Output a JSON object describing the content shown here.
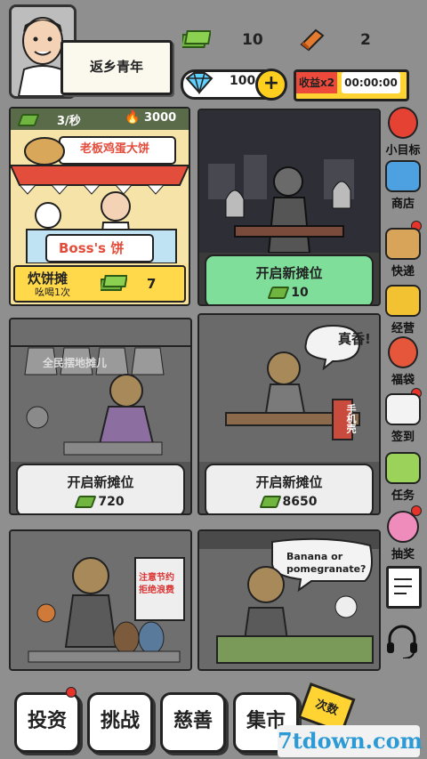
{
  "header": {
    "title": "返乡青年",
    "cash": "10",
    "bricks": "2",
    "diamonds": "100",
    "plus_label": "+",
    "boost_label": "收益x2",
    "timer": "00:00:00"
  },
  "stalls": [
    {
      "rate": "3/秒",
      "fire": "3000",
      "sign": "老板鸡蛋大饼",
      "board": "Boss's 饼",
      "name": "炊饼摊",
      "sub": "吆喝1次",
      "cost": "7"
    },
    {
      "label": "开启新摊位",
      "cost": "10"
    },
    {
      "label": "开启新摊位",
      "cost": "720",
      "banner": "全民摆地摊儿"
    },
    {
      "label": "开启新摊位",
      "cost": "8650",
      "speech": "真香!",
      "sign": "手机壳"
    },
    {
      "sign": "注意节约 拒绝浪费"
    },
    {
      "speech": "Banana or pomegranate?"
    }
  ],
  "side_menu": [
    {
      "label": "小目标",
      "icon": "target-icon",
      "color": "#e64234"
    },
    {
      "label": "商店",
      "icon": "shop-icon",
      "color": "#4da1e0"
    },
    {
      "label": "快递",
      "icon": "parcel-icon",
      "color": "#d7a45a"
    },
    {
      "label": "经营",
      "icon": "gold-bar-icon",
      "color": "#f2c232"
    },
    {
      "label": "福袋",
      "icon": "lucky-bag-icon",
      "color": "#e6563a"
    },
    {
      "label": "签到",
      "icon": "calendar-icon",
      "color": "#f3f3f3"
    },
    {
      "label": "任务",
      "icon": "clipboard-icon",
      "color": "#9bd35a"
    },
    {
      "label": "抽奖",
      "icon": "wheel-icon",
      "color": "#f08cbc"
    }
  ],
  "bottom_nav": [
    {
      "label": "投资"
    },
    {
      "label": "挑战"
    },
    {
      "label": "慈善"
    },
    {
      "label": "集市"
    }
  ],
  "corner_badge": "次数",
  "watermark": "7tdown.com"
}
